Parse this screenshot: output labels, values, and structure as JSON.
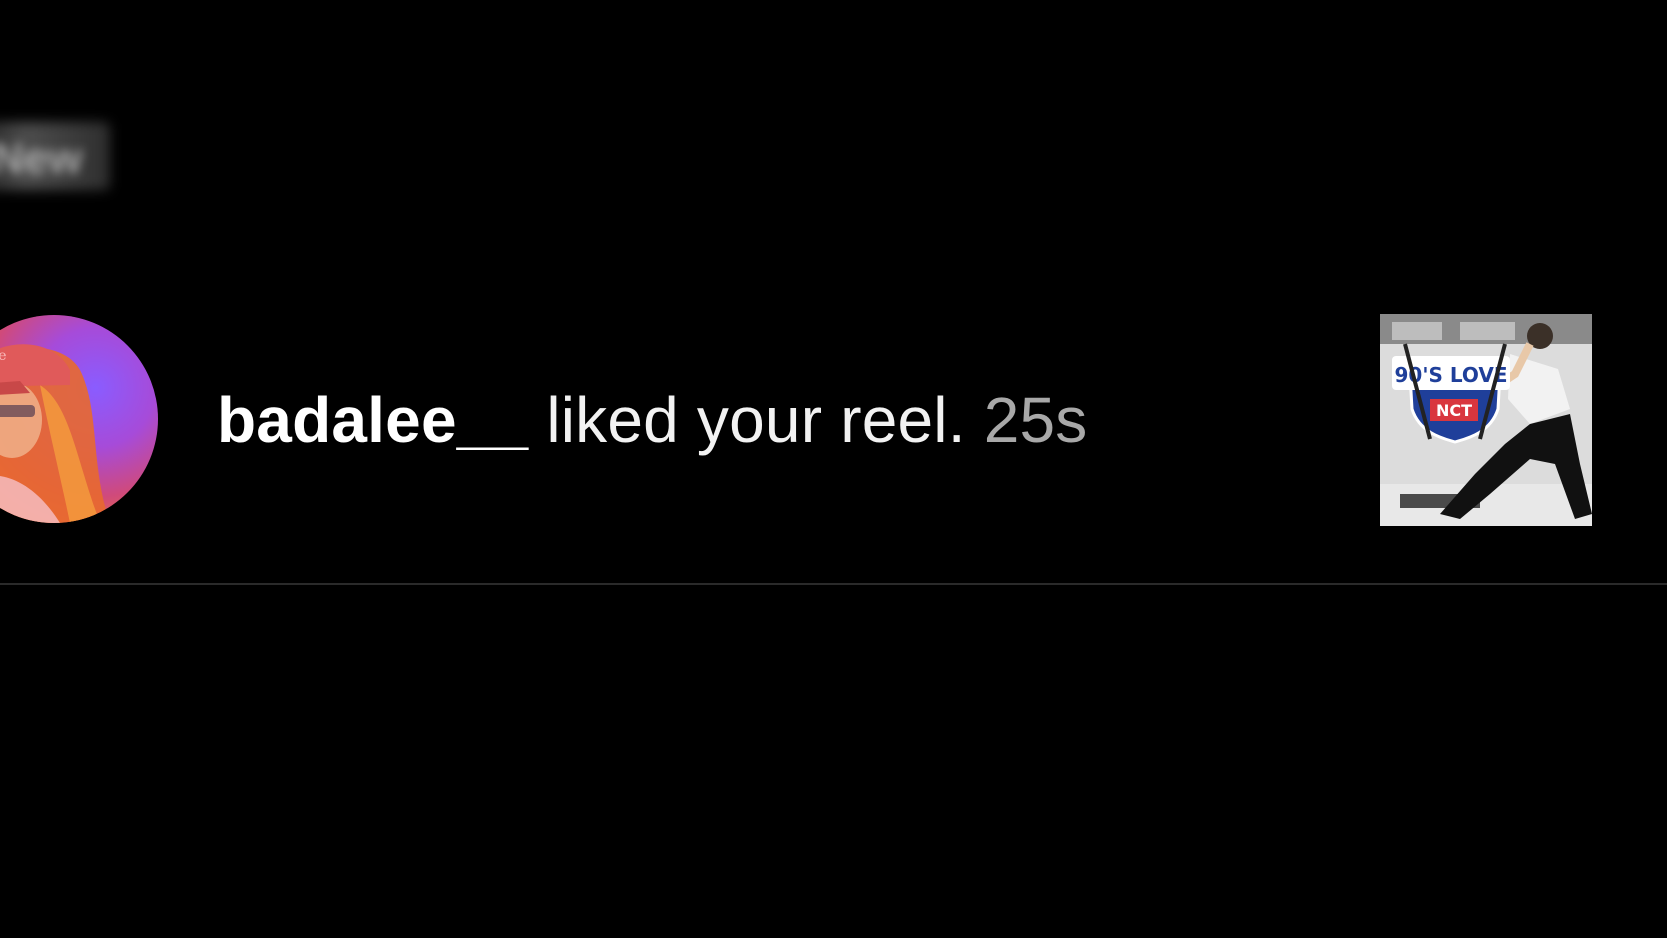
{
  "section": {
    "header_label": "New"
  },
  "notification": {
    "username": "badalee__",
    "action_text": " liked your reel.",
    "timestamp": " 25s",
    "avatar_icon": "user-avatar",
    "thumbnail_icon": "reel-thumbnail",
    "thumbnail_sticker_text": "90'S LOVE",
    "thumbnail_sticker_subtext": "NCT"
  },
  "colors": {
    "background": "#000000",
    "username": "#ffffff",
    "action": "#f2f2f2",
    "timestamp": "#a8a8a8",
    "divider": "#2a2a2a"
  }
}
